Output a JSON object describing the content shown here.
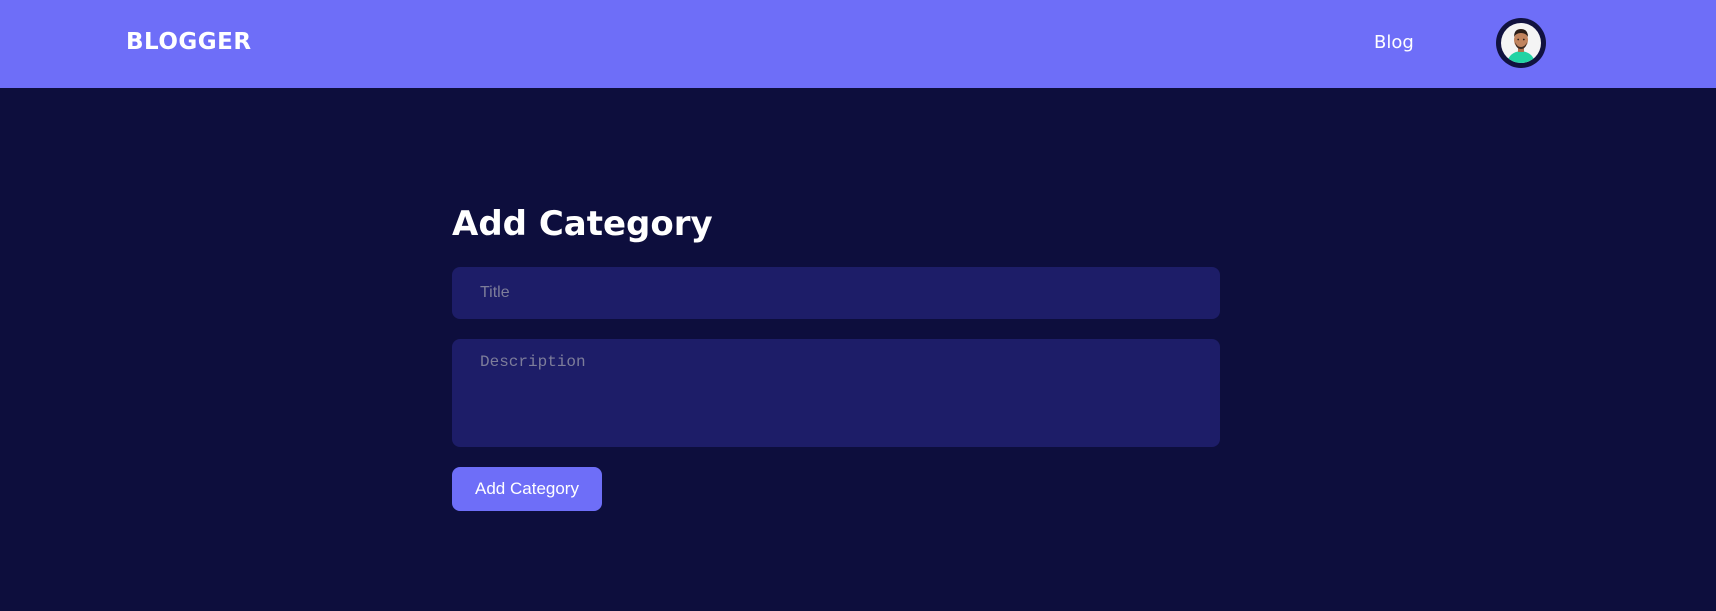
{
  "navbar": {
    "brand": "BLOGGER",
    "links": [
      {
        "label": "Blog"
      }
    ],
    "avatar_icon": "user-avatar-photo"
  },
  "form": {
    "heading": "Add Category",
    "title_placeholder": "Title",
    "title_value": "",
    "description_placeholder": "Description",
    "description_value": "",
    "submit_label": "Add Category"
  },
  "colors": {
    "page_background": "#0d0e3d",
    "navbar_background": "#6e6ef8",
    "field_background": "#1d1d68",
    "button_background": "#6e6ef8",
    "text": "#ffffff",
    "placeholder": "#7d7d9a"
  }
}
